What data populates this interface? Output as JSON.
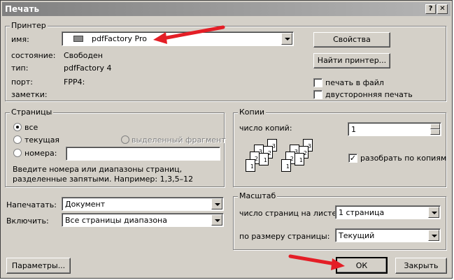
{
  "title": "Печать",
  "title_buttons": {
    "help": "?",
    "close": "✕"
  },
  "printer": {
    "group_label": "Принтер",
    "name_label": "имя:",
    "name_value": "pdfFactory Pro",
    "status_label": "состояние:",
    "status_value": "Свободен",
    "type_label": "тип:",
    "type_value": "pdfFactory 4",
    "port_label": "порт:",
    "port_value": "FPP4:",
    "notes_label": "заметки:",
    "properties_button": "Свойства",
    "find_printer_button": "Найти принтер...",
    "print_to_file": "печать в файл",
    "duplex": "двусторонняя печать"
  },
  "pages": {
    "group_label": "Страницы",
    "all": "все",
    "current": "текущая",
    "selection": "выделенный фрагмент",
    "numbers": "номера:",
    "hint": "Введите номера или диапазоны страниц, разделенные запятыми. Например: 1,3,5–12"
  },
  "copies": {
    "group_label": "Копии",
    "count_label": "число копий:",
    "count_value": "1",
    "collate": "разобрать по копиям",
    "page_numbers": [
      "1",
      "2",
      "3"
    ]
  },
  "print_what": {
    "label": "Напечатать:",
    "value": "Документ"
  },
  "include": {
    "label": "Включить:",
    "value": "Все страницы диапазона"
  },
  "zoom": {
    "group_label": "Масштаб",
    "pages_per_sheet_label": "число страниц на листе:",
    "pages_per_sheet_value": "1 страница",
    "scale_label": "по размеру страницы:",
    "scale_value": "Текущий"
  },
  "buttons": {
    "options": "Параметры...",
    "ok": "ОК",
    "close": "Закрыть"
  },
  "colors": {
    "annotation_arrow": "#e41e26"
  }
}
